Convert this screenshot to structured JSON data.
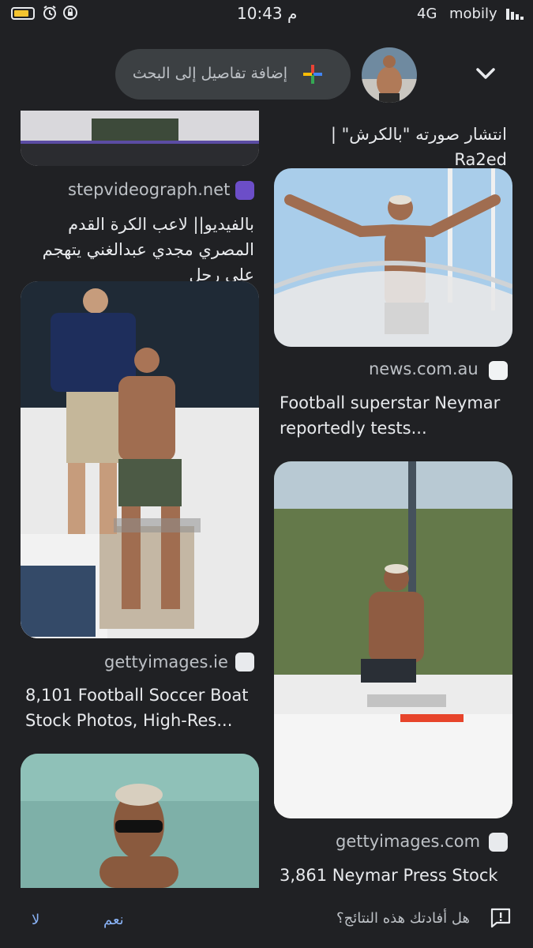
{
  "status_bar": {
    "time": "10:43 م",
    "network": "4G",
    "carrier": "mobily",
    "icons": [
      "battery-icon",
      "alarm-icon",
      "rotation-lock-icon",
      "signal-icon"
    ]
  },
  "search": {
    "placeholder": "إضافة تفاصيل إلى البحث",
    "icons": [
      "google-plus-icon",
      "chevron-down-icon"
    ]
  },
  "results": {
    "left": [
      {
        "source": "stepvideograph.net",
        "title": "بالفيديو|| لاعب الكرة القدم المصري مجدي عبدالغني يتهجم على رجل"
      },
      {
        "source": "gettyimages.ie",
        "title": "8,101 Football Soccer Boat Stock Photos, High-Res..."
      },
      {
        "source": "",
        "title": ""
      }
    ],
    "right": [
      {
        "source": "",
        "title": "انتشار صورته \"بالكرش\" | Ra2ed"
      },
      {
        "source": "news.com.au",
        "title": "Football superstar Neymar reportedly tests..."
      },
      {
        "source": "gettyimages.com",
        "title": "3,861 Neymar Press Stock"
      }
    ]
  },
  "feedback": {
    "question": "هل أفادتك هذه النتائج؟",
    "yes_label": "نعم",
    "no_label": "لا"
  },
  "colors": {
    "background": "#202124",
    "link_blue": "#8ab4f8",
    "pill": "#3c4043"
  }
}
